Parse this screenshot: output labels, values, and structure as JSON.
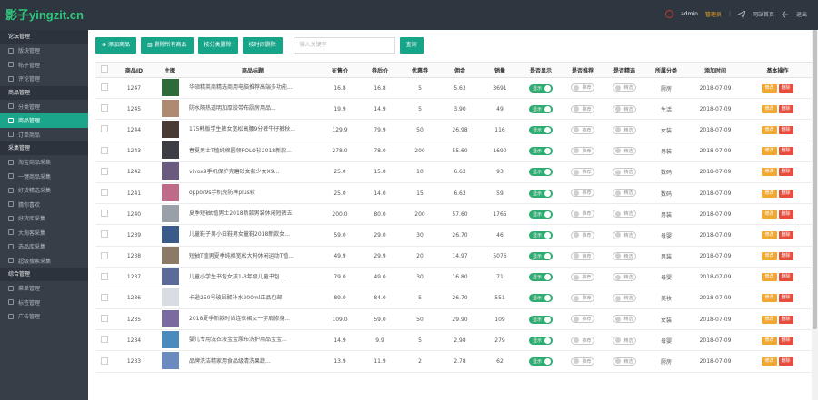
{
  "header": {
    "logo": "影子yingzit.cn",
    "user": "admin",
    "role": "管理员",
    "home": "网站首页",
    "logout": "退出"
  },
  "sidebar": [
    {
      "section": "论坛管理",
      "items": [
        "版块管理",
        "帖子管理",
        "评论管理"
      ]
    },
    {
      "section": "商品管理",
      "items": [
        "分类管理",
        "商品管理",
        "订单商品"
      ],
      "active": "商品管理"
    },
    {
      "section": "采集管理",
      "items": [
        "淘宝商品采集",
        "一键商品采集",
        "好货精选采集",
        "猜你喜欢",
        "好货库采集",
        "大淘客采集",
        "选品库采集",
        "超级搜索采集"
      ]
    },
    {
      "section": "综合管理",
      "items": [
        "菜单管理",
        "标签管理",
        "广告管理"
      ]
    }
  ],
  "toolbar": {
    "add": "添加商品",
    "clear_all": "删除所有商品",
    "clear_by_time": "按分类删除",
    "clear_expired": "按时间删除",
    "search_placeholder": "输入关键字",
    "search_btn": "查询"
  },
  "columns": [
    "",
    "商品ID",
    "主图",
    "商品标题",
    "在售价",
    "券后价",
    "优惠券",
    "佣金",
    "销量",
    "是否显示",
    "是否推荐",
    "是否精选",
    "所属分类",
    "添加时间",
    "基本操作"
  ],
  "toggle_labels": {
    "on": "显示",
    "off": "隐藏",
    "rec": "推荐",
    "pick": "精选"
  },
  "ops": {
    "edit": "修改",
    "del": "删除"
  },
  "rows": [
    {
      "id": "1247",
      "title": "华硕精英商精选商用电脑推荐高端多功能...",
      "price": "16.8",
      "after": "16.8",
      "coupon": "5",
      "comm": "5.63",
      "sales": "3691",
      "cat": "厨房",
      "date": "2018-07-09",
      "thumb": "#2d6b3a"
    },
    {
      "id": "1245",
      "title": "防水隔热透明加厚胶带布厨房用品...",
      "price": "19.9",
      "after": "14.9",
      "coupon": "5",
      "comm": "3.90",
      "sales": "49",
      "cat": "生活",
      "date": "2018-07-09",
      "thumb": "#b08a70"
    },
    {
      "id": "1244",
      "title": "175韩版学生裤女宽松高腰9分裤牛仔裤秋...",
      "price": "129.9",
      "after": "79.9",
      "coupon": "50",
      "comm": "26.98",
      "sales": "116",
      "cat": "女装",
      "date": "2018-07-09",
      "thumb": "#4a3a36"
    },
    {
      "id": "1243",
      "title": "春夏男士T恤纯棉圆领POLO衫2018新款...",
      "price": "278.0",
      "after": "78.0",
      "coupon": "200",
      "comm": "55.60",
      "sales": "1690",
      "cat": "男装",
      "date": "2018-07-09",
      "thumb": "#3d3d46"
    },
    {
      "id": "1242",
      "title": "vivox9手机保护壳磨砂女款少女X9...",
      "price": "25.0",
      "after": "15.0",
      "coupon": "10",
      "comm": "6.63",
      "sales": "93",
      "cat": "数码",
      "date": "2018-07-09",
      "thumb": "#6b5a80"
    },
    {
      "id": "1241",
      "title": "oppor9s手机壳防摔plus软",
      "price": "25.0",
      "after": "14.0",
      "coupon": "15",
      "comm": "6.63",
      "sales": "59",
      "cat": "数码",
      "date": "2018-07-09",
      "thumb": "#c06a8a"
    },
    {
      "id": "1240",
      "title": "夏季短袖t恤男士2018新款男装休闲短裤五",
      "price": "200.0",
      "after": "80.0",
      "coupon": "200",
      "comm": "57.60",
      "sales": "1765",
      "cat": "男装",
      "date": "2018-07-09",
      "thumb": "#9aa0a8"
    },
    {
      "id": "1239",
      "title": "儿童鞋子男小白鞋男女童鞋2018新款女...",
      "price": "59.0",
      "after": "29.0",
      "coupon": "30",
      "comm": "26.70",
      "sales": "46",
      "cat": "母婴",
      "date": "2018-07-09",
      "thumb": "#3a5a8a"
    },
    {
      "id": "1238",
      "title": "短袖T恤男夏季纯棉宽松大码休闲运动T恤...",
      "price": "49.9",
      "after": "29.9",
      "coupon": "20",
      "comm": "14.97",
      "sales": "5076",
      "cat": "男装",
      "date": "2018-07-09",
      "thumb": "#8a7a66"
    },
    {
      "id": "1237",
      "title": "儿童小学生书包女孩1-3年级儿童书包...",
      "price": "79.0",
      "after": "49.0",
      "coupon": "30",
      "comm": "16.80",
      "sales": "71",
      "cat": "母婴",
      "date": "2018-07-09",
      "thumb": "#5a6b9a"
    },
    {
      "id": "1236",
      "title": "卡逊250号玻尿酸补水200ml正品包邮",
      "price": "89.0",
      "after": "84.0",
      "coupon": "5",
      "comm": "26.70",
      "sales": "551",
      "cat": "美妆",
      "date": "2018-07-09",
      "thumb": "#d8dde4"
    },
    {
      "id": "1235",
      "title": "2018夏季新款时尚连衣裙女一字肩修身...",
      "price": "109.0",
      "after": "59.0",
      "coupon": "50",
      "comm": "29.90",
      "sales": "109",
      "cat": "女装",
      "date": "2018-07-09",
      "thumb": "#7a6aa0"
    },
    {
      "id": "1234",
      "title": "婴儿专用洗衣液宝宝尿布洗护用品宝宝...",
      "price": "14.9",
      "after": "9.9",
      "coupon": "5",
      "comm": "2.98",
      "sales": "279",
      "cat": "母婴",
      "date": "2018-07-09",
      "thumb": "#4a8abd"
    },
    {
      "id": "1233",
      "title": "品牌洗洁精家用食品级清洗果蔬...",
      "price": "13.9",
      "after": "11.9",
      "coupon": "2",
      "comm": "2.78",
      "sales": "62",
      "cat": "厨房",
      "date": "2018-07-09",
      "thumb": "#6a8ac0"
    }
  ]
}
